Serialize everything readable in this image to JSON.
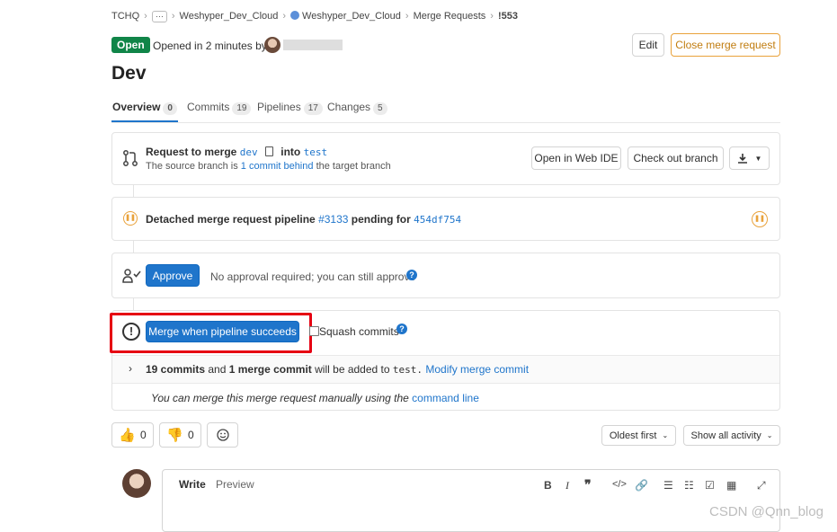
{
  "breadcrumb": {
    "items": [
      "TCHQ",
      "···",
      "Weshyper_Dev_Cloud",
      "Weshyper_Dev_Cloud",
      "Merge Requests",
      "!553"
    ]
  },
  "header": {
    "status": "Open",
    "opened_text": "Opened in 2 minutes by",
    "edit_label": "Edit",
    "close_label": "Close merge request",
    "title": "Dev"
  },
  "tabs": [
    {
      "label": "Overview",
      "count": "0"
    },
    {
      "label": "Commits",
      "count": "19"
    },
    {
      "label": "Pipelines",
      "count": "17"
    },
    {
      "label": "Changes",
      "count": "5"
    }
  ],
  "merge_info": {
    "request_to_merge": "Request to merge",
    "source": "dev",
    "into": "into",
    "target": "test",
    "status_prefix": "The source branch is",
    "status_link": "1 commit behind",
    "status_suffix": "the target branch",
    "open_ide": "Open in Web IDE",
    "checkout": "Check out branch"
  },
  "pipeline": {
    "prefix": "Detached merge request pipeline",
    "id": "#3133",
    "middle": "pending for",
    "sha": "454df754"
  },
  "approval": {
    "button": "Approve",
    "text": "No approval required; you can still approve"
  },
  "merge": {
    "button": "Merge when pipeline succeeds",
    "squash": "Squash commits",
    "commits_a": "19 commits",
    "commits_and": "and",
    "commits_b": "1 merge commit",
    "commits_suffix": "will be added to",
    "commits_target": "test.",
    "modify": "Modify merge commit",
    "manual_text": "You can merge this merge request manually using the",
    "manual_link": "command line"
  },
  "reactions": {
    "thumbs_up": "0",
    "thumbs_down": "0"
  },
  "activity": {
    "sort": "Oldest first",
    "filter": "Show all activity"
  },
  "editor": {
    "write": "Write",
    "preview": "Preview"
  },
  "watermark": "CSDN @Qnn_blog",
  "colors": {
    "open_badge": "#108548",
    "primary": "#1f75cb",
    "warning": "#e9a23b",
    "highlight": "#e60012"
  }
}
